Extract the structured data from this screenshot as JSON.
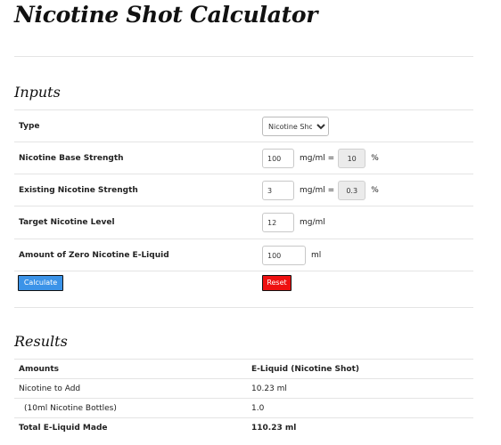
{
  "page": {
    "title": "Nicotine Shot Calculator"
  },
  "inputs": {
    "heading": "Inputs",
    "type": {
      "label": "Type",
      "selected": "Nicotine Shot"
    },
    "base_strength": {
      "label": "Nicotine Base Strength",
      "value": "100",
      "unit": "mg/ml =",
      "percent_value": "10",
      "percent_unit": "%"
    },
    "existing_strength": {
      "label": "Existing Nicotine Strength",
      "value": "3",
      "unit": "mg/ml =",
      "percent_value": "0.3",
      "percent_unit": "%"
    },
    "target_level": {
      "label": "Target Nicotine Level",
      "value": "12",
      "unit": "mg/ml"
    },
    "zero_nicotine_amount": {
      "label": "Amount of Zero Nicotine E-Liquid",
      "value": "100",
      "unit": "ml"
    },
    "calculate_label": "Calculate",
    "reset_label": "Reset"
  },
  "results": {
    "heading": "Results",
    "headers": [
      "Amounts",
      "E-Liquid (Nicotine Shot)"
    ],
    "rows": [
      {
        "label": "Nicotine to Add",
        "value": "10.23 ml"
      },
      {
        "label": "(10ml Nicotine Bottles)",
        "value": "1.0"
      },
      {
        "label": "Total E-Liquid Made",
        "value": "110.23 ml"
      }
    ]
  },
  "colors": {
    "calculate_button": "#3b93e8",
    "reset_button": "#ee1111"
  }
}
